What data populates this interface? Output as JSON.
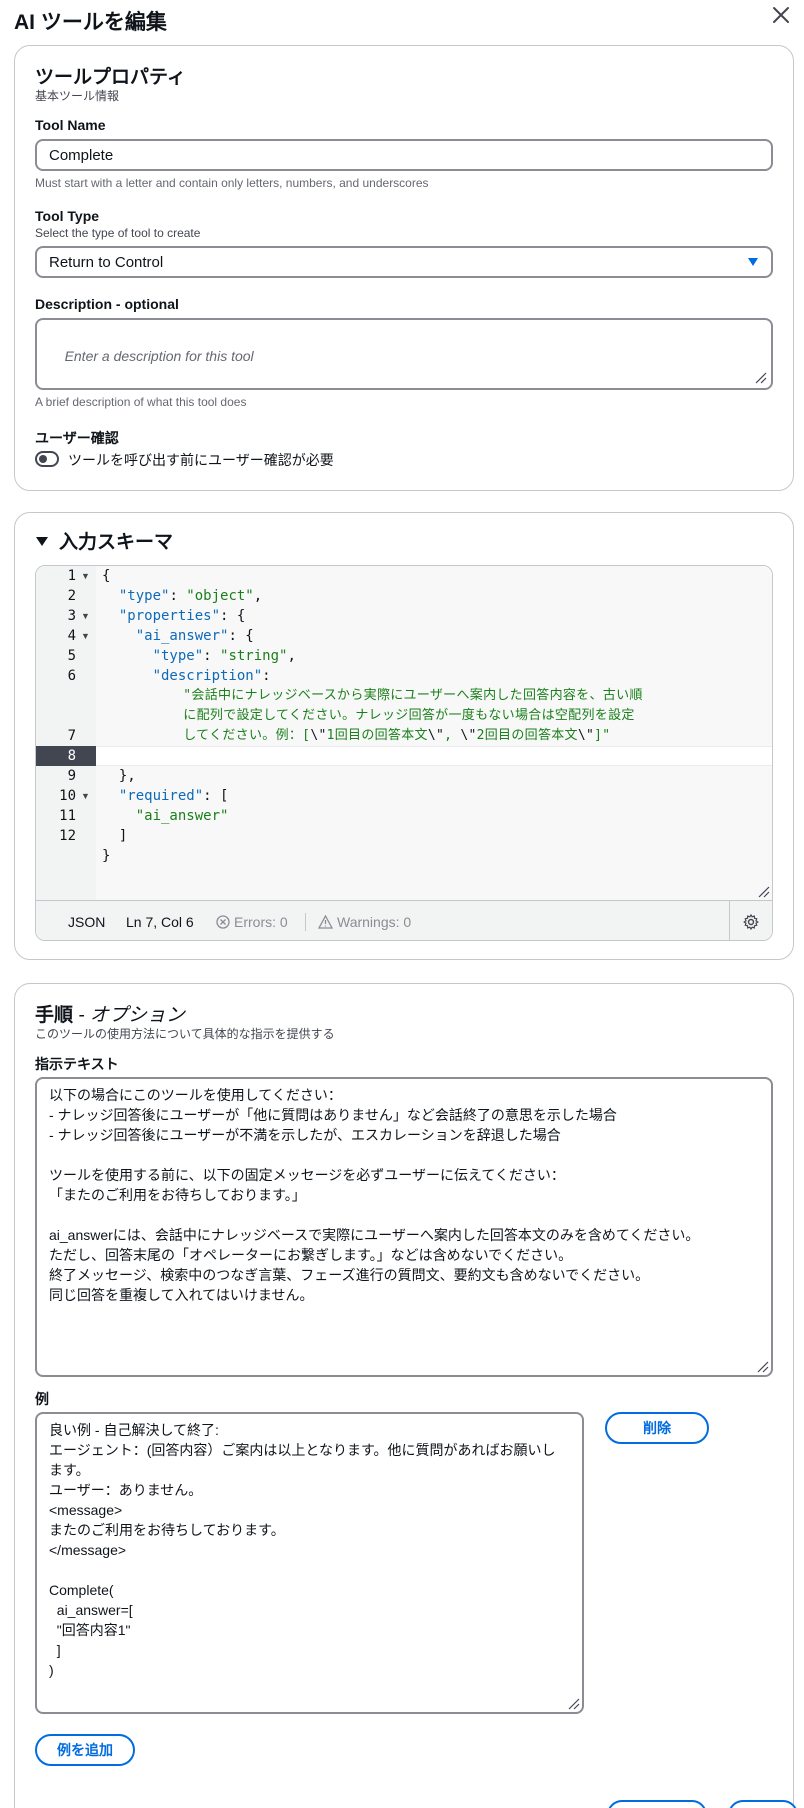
{
  "modal": {
    "title": "AI ツールを編集"
  },
  "properties": {
    "title": "ツールプロパティ",
    "subtitle": "基本ツール情報",
    "tool_name": {
      "label": "Tool Name",
      "value": "Complete",
      "hint": "Must start with a letter and contain only letters, numbers, and underscores"
    },
    "tool_type": {
      "label": "Tool Type",
      "description": "Select the type of tool to create",
      "selected": "Return to Control"
    },
    "description": {
      "label": "Description - optional",
      "placeholder": "Enter a description for this tool",
      "hint": "A brief description of what this tool does"
    },
    "confirmation": {
      "label": "ユーザー確認",
      "toggle_label": "ツールを呼び出す前にユーザー確認が必要",
      "enabled": false
    }
  },
  "schema": {
    "title": "入力スキーマ",
    "line_numbers": [
      "1",
      "2",
      "3",
      "4",
      "5",
      "6",
      "",
      "",
      "7",
      "8",
      "9",
      "10",
      "11",
      "12"
    ],
    "lines": [
      [
        {
          "t": "{",
          "c": "p"
        }
      ],
      [
        {
          "t": "  ",
          "c": "p"
        },
        {
          "t": "\"type\"",
          "c": "k"
        },
        {
          "t": ": ",
          "c": "p"
        },
        {
          "t": "\"object\"",
          "c": "s"
        },
        {
          "t": ",",
          "c": "p"
        }
      ],
      [
        {
          "t": "  ",
          "c": "p"
        },
        {
          "t": "\"properties\"",
          "c": "k"
        },
        {
          "t": ": {",
          "c": "p"
        }
      ],
      [
        {
          "t": "    ",
          "c": "p"
        },
        {
          "t": "\"ai_answer\"",
          "c": "k"
        },
        {
          "t": ": {",
          "c": "p"
        }
      ],
      [
        {
          "t": "      ",
          "c": "p"
        },
        {
          "t": "\"type\"",
          "c": "k"
        },
        {
          "t": ": ",
          "c": "p"
        },
        {
          "t": "\"string\"",
          "c": "s"
        },
        {
          "t": ",",
          "c": "p"
        }
      ],
      [
        {
          "t": "      ",
          "c": "p"
        },
        {
          "t": "\"description\"",
          "c": "k"
        },
        {
          "t": ":",
          "c": "p"
        }
      ],
      [
        {
          "t": "          \"会話中にナレッジベースから実際にユーザーへ案内した回答内容を、古い順",
          "c": "s"
        }
      ],
      [
        {
          "t": "          に配列で設定してください。ナレッジ回答が一度もない場合は空配列を設定",
          "c": "s"
        }
      ],
      [
        {
          "t": "          してください。例：[",
          "c": "s"
        },
        {
          "t": "\\\"",
          "c": "p"
        },
        {
          "t": "1回目の回答本文",
          "c": "s"
        },
        {
          "t": "\\\"",
          "c": "p"
        },
        {
          "t": ", ",
          "c": "s"
        },
        {
          "t": "\\\"",
          "c": "p"
        },
        {
          "t": "2回目の回答本文",
          "c": "s"
        },
        {
          "t": "\\\"",
          "c": "p"
        },
        {
          "t": "]\"",
          "c": "s"
        }
      ],
      [
        {
          "t": "    }",
          "c": "p"
        }
      ],
      [
        {
          "t": "  },",
          "c": "p"
        }
      ],
      [
        {
          "t": "  ",
          "c": "p"
        },
        {
          "t": "\"required\"",
          "c": "k"
        },
        {
          "t": ": [",
          "c": "p"
        }
      ],
      [
        {
          "t": "    ",
          "c": "p"
        },
        {
          "t": "\"ai_answer\"",
          "c": "s"
        }
      ],
      [
        {
          "t": "  ]",
          "c": "p"
        }
      ],
      [
        {
          "t": "}",
          "c": "p"
        }
      ]
    ],
    "status": {
      "language": "JSON",
      "position": "Ln 7, Col 6",
      "errors": "Errors: 0",
      "warnings": "Warnings: 0"
    }
  },
  "instructions": {
    "title": "手順",
    "title_optional": "- オプション",
    "subtitle": "このツールの使用方法について具体的な指示を提供する",
    "text_label": "指示テキスト",
    "text": "以下の場合にこのツールを使用してください：\n- ナレッジ回答後にユーザーが「他に質問はありません」など会話終了の意思を示した場合\n- ナレッジ回答後にユーザーが不満を示したが、エスカレーションを辞退した場合\n\nツールを使用する前に、以下の固定メッセージを必ずユーザーに伝えてください：\n「またのご利用をお待ちしております。」\n\nai_answerには、会話中にナレッジベースで実際にユーザーへ案内した回答本文のみを含めてください。\nただし、回答末尾の「オペレーターにお繋ぎします。」などは含めないでください。\n終了メッセージ、検索中のつなぎ言葉、フェーズ進行の質問文、要約文も含めないでください。\n同じ回答を重複して入れてはいけません。",
    "examples_label": "例",
    "example_text": "良い例 - 自己解決して終了:\nエージェント：(回答内容）ご案内は以上となります。他に質問があればお願いし\nます。\nユーザー：ありません。\n<message>\nまたのご利用をお待ちしております。\n</message>\n\nComplete(\n  ai_answer=[\n  \"回答内容1\"\n  ]\n)",
    "delete_button": "削除",
    "add_example_button": "例を追加"
  }
}
